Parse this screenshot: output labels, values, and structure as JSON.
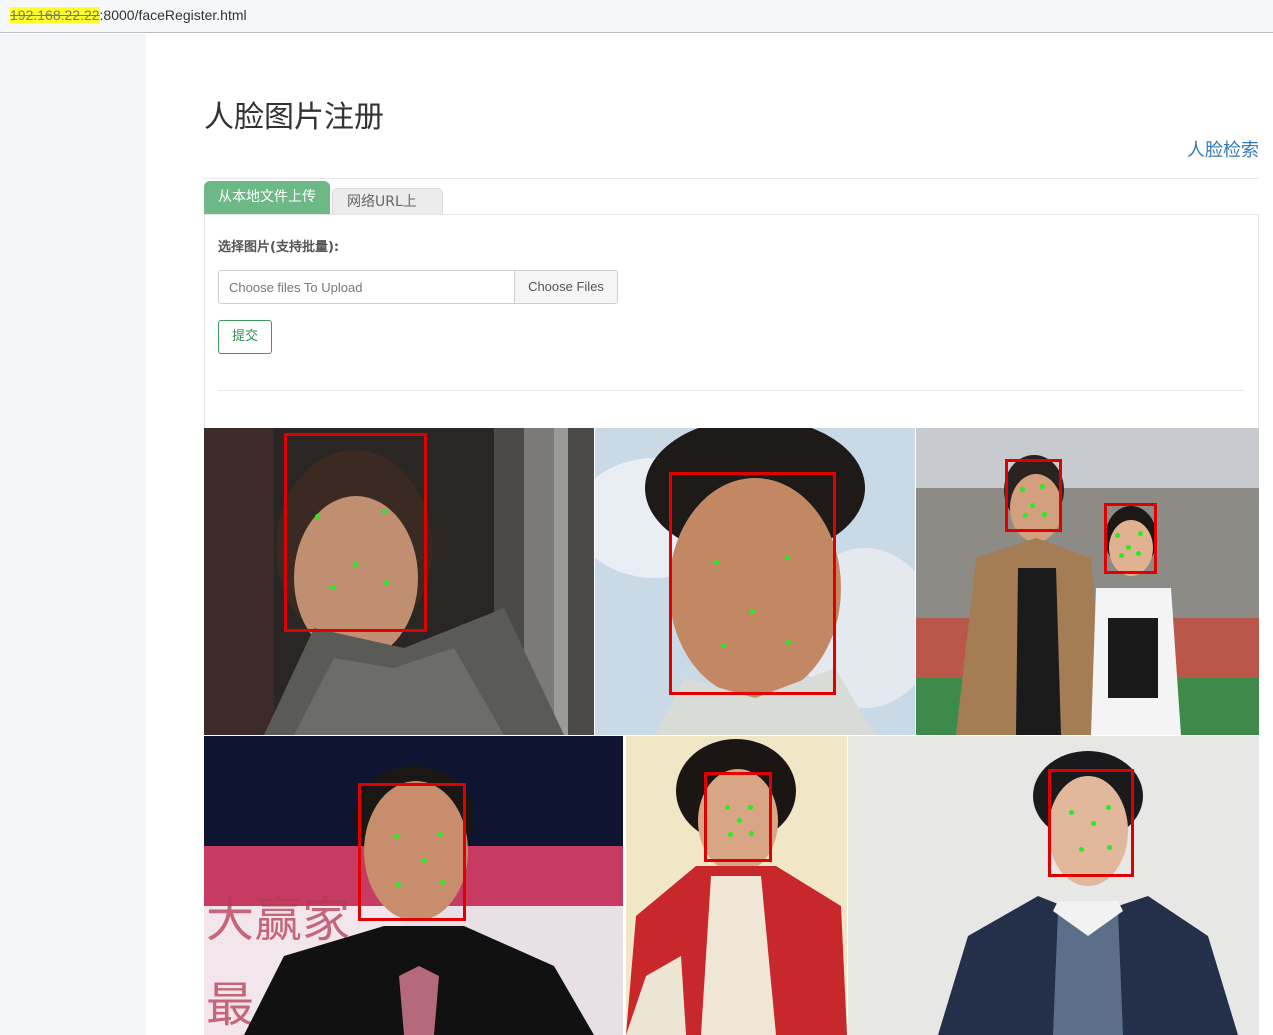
{
  "browser": {
    "url_masked": "192.168.22.22",
    "url_rest": ":8000/faceRegister.html"
  },
  "page": {
    "title": "人脸图片注册",
    "search_link": "人脸检索"
  },
  "tabs": [
    {
      "label": "从本地文件上传",
      "active": true
    },
    {
      "label": "网络URL上传",
      "active": false
    }
  ],
  "upload": {
    "label": "选择图片(支持批量):",
    "placeholder": "Choose files To Upload",
    "choose_button": "Choose Files",
    "submit_button": "提交"
  },
  "results": {
    "image_count": 6,
    "box_color": "#e00000",
    "landmark_color": "#22ee22"
  },
  "colors": {
    "active_tab": "#6cb886",
    "link": "#337ab7",
    "submit_border": "#3c9a5f"
  }
}
